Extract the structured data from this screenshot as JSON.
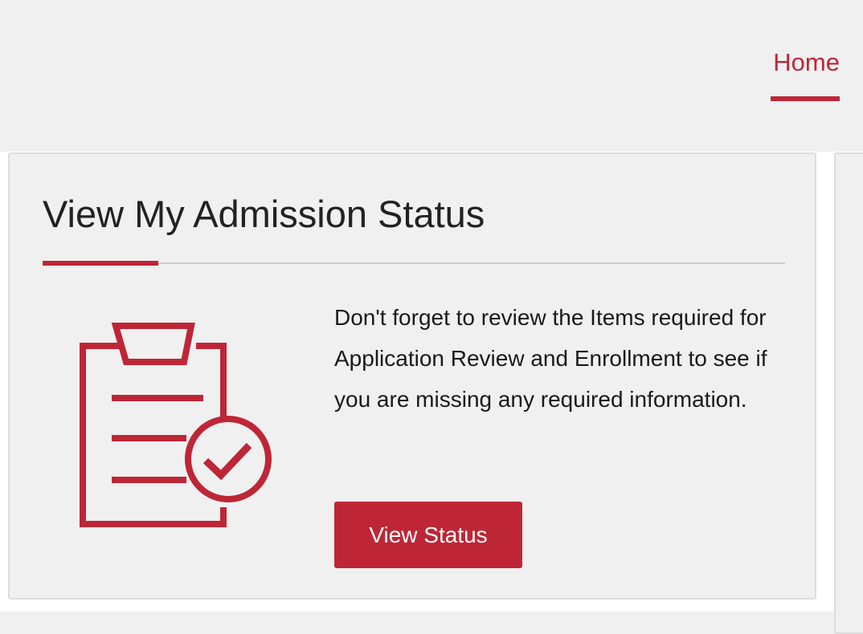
{
  "nav": {
    "home_label": "Home"
  },
  "card": {
    "title": "View My Admission Status",
    "description": "Don't forget to review the Items required for Application Review and Enrollment to see if you are missing any required information.",
    "button_label": "View Status",
    "icon": "clipboard-check-icon"
  },
  "colors": {
    "accent": "#be2636",
    "background": "#f0f0f0",
    "border": "#dcdcdc",
    "text": "#222222"
  }
}
